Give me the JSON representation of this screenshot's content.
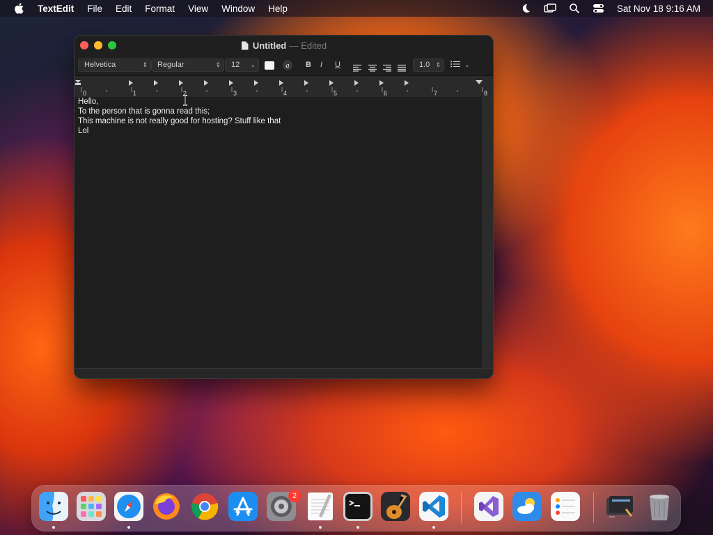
{
  "menubar": {
    "app_name": "TextEdit",
    "menus": [
      "File",
      "Edit",
      "Format",
      "View",
      "Window",
      "Help"
    ],
    "clock": "Sat Nov 18  9:16 AM"
  },
  "window": {
    "title": "Untitled",
    "separator": "—",
    "status": "Edited",
    "toolbar": {
      "font_family": "Helvetica",
      "font_style": "Regular",
      "font_size": "12",
      "bold": "B",
      "italic": "I",
      "underline": "U",
      "line_spacing": "1.0"
    },
    "ruler_labels": [
      "0",
      "1",
      "2",
      "3",
      "4",
      "5",
      "6",
      "7",
      "8"
    ],
    "document_lines": [
      "Hello,",
      "To the person that is gonna read this;",
      "This machine is not really good for hosting? Stuff like that",
      "Lol"
    ]
  },
  "dock": {
    "items": [
      "finder-icon",
      "launchpad-icon",
      "safari-icon",
      "firefox-icon",
      "chrome-icon",
      "app-store-icon",
      "system-settings-icon",
      "textedit-icon",
      "terminal-icon",
      "garageband-icon",
      "vscode-icon",
      "visual-studio-icon",
      "weather-icon",
      "reminders-icon",
      "screenshot-folder-icon",
      "trash-icon"
    ],
    "settings_badge": "2"
  },
  "colors": {
    "close": "#fe5f57",
    "minimize": "#febc2e",
    "zoom": "#28c840",
    "badge": "#ff3b30"
  }
}
